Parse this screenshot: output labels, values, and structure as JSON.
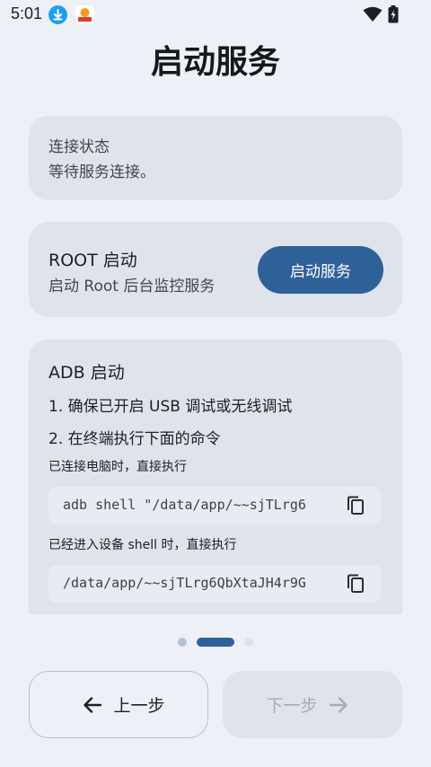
{
  "status_bar": {
    "time": "5:01",
    "icons": [
      "download-notification-icon",
      "app-notification-icon",
      "wifi-icon",
      "battery-icon"
    ]
  },
  "page": {
    "title": "启动服务"
  },
  "status_card": {
    "label": "连接状态",
    "value": "等待服务连接。"
  },
  "root_card": {
    "title": "ROOT 启动",
    "description": "启动 Root 后台监控服务",
    "button_label": "启动服务"
  },
  "adb_card": {
    "title": "ADB 启动",
    "step1": "1. 确保已开启 USB 调试或无线调试",
    "step2": "2. 在终端执行下面的命令",
    "hint_pc": "已连接电脑时，直接执行",
    "command_pc": "adb shell \"/data/app/~~sjTLrg6",
    "hint_shell": "已经进入设备 shell 时，直接执行",
    "command_shell": "/data/app/~~sjTLrg6QbXtaJH4r9G"
  },
  "pager": {
    "count": 3,
    "active_index": 1
  },
  "nav": {
    "prev_label": "上一步",
    "next_label": "下一步"
  },
  "colors": {
    "background": "#eef0f7",
    "card": "#dfe3ec",
    "accent": "#2f6199",
    "disabled_text": "#a6abb5"
  }
}
